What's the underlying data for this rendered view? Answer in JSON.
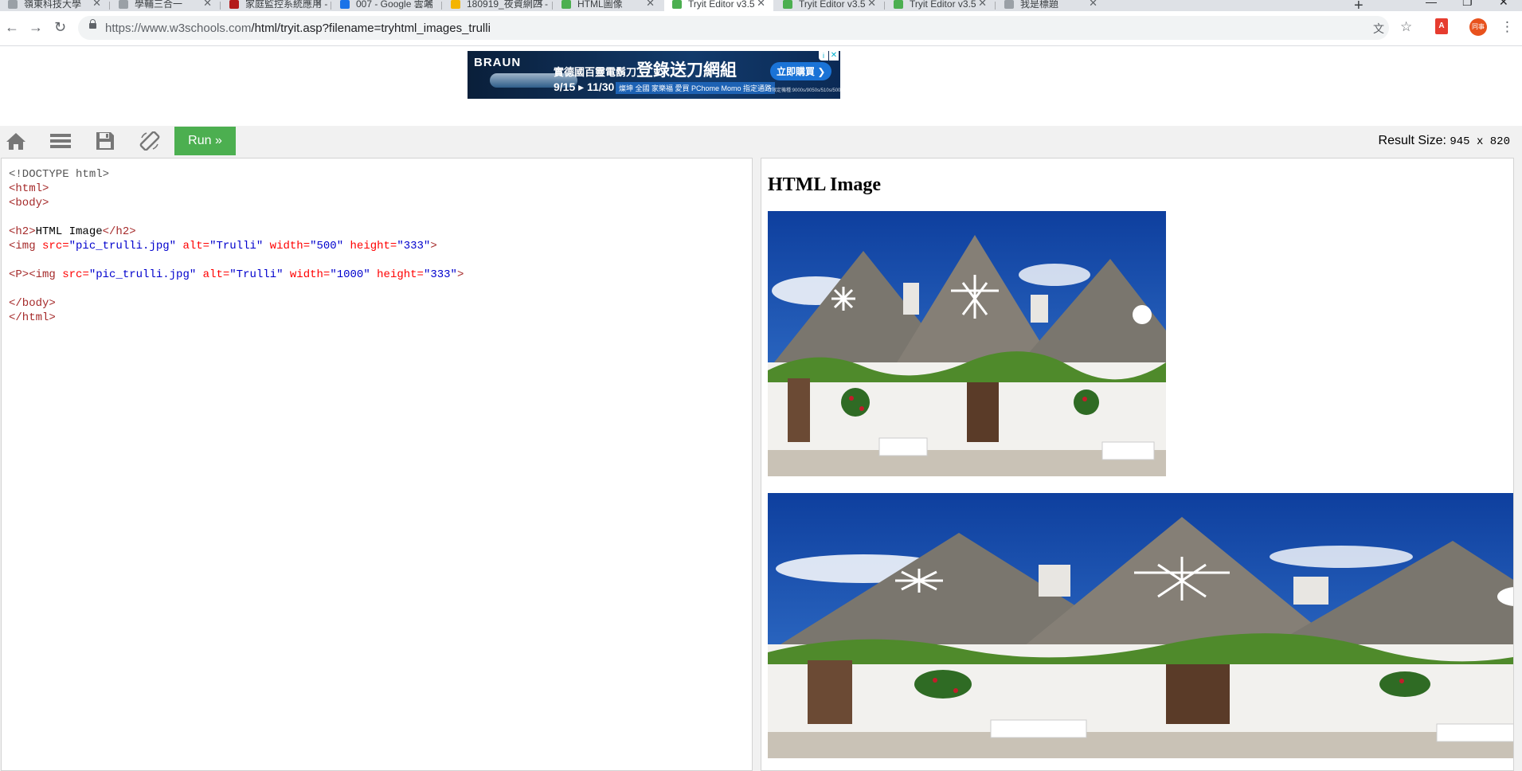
{
  "browser": {
    "tabs": [
      {
        "title": "嶺東科技大學",
        "favicon_color": "#9aa0a6"
      },
      {
        "title": "學輔三合一",
        "favicon_color": "#9aa0a6"
      },
      {
        "title": "家庭監控系統應用 -",
        "favicon_color": "#b31b1b"
      },
      {
        "title": "007 - Google 雲端",
        "favicon_color": "#1a73e8"
      },
      {
        "title": "180919_夜資網四 -",
        "favicon_color": "#f4b400"
      },
      {
        "title": "HTML圖像",
        "favicon_color": "#4caf50"
      },
      {
        "title": "Tryit Editor v3.5",
        "favicon_color": "#4caf50",
        "active": true
      },
      {
        "title": "Tryit Editor v3.5",
        "favicon_color": "#4caf50"
      },
      {
        "title": "Tryit Editor v3.5",
        "favicon_color": "#4caf50"
      },
      {
        "title": "我是標題",
        "favicon_color": "#9aa0a6"
      }
    ],
    "new_tab_label": "+",
    "url_host": "https://www.w3schools.com",
    "url_path": "/html/tryit.asp?filename=tryhtml_images_trulli",
    "profile_label": "同事"
  },
  "ad": {
    "brand": "BRAUN",
    "headline_small": "實德國百靈電鬍刀",
    "headline_big": "登錄送刀網組",
    "date_range": "9/15 ▸ 11/30",
    "sub": "燦坤 全國 家樂福 愛買 PChome Momo 指定通路",
    "cta": "立即購買 ❯",
    "fine_print": "限定機種:9000s/9050s/510s/500s"
  },
  "editor": {
    "run_label": "Run »",
    "result_size_label": "Result Size:",
    "result_size_value": "945 x 820"
  },
  "code_lines": [
    [
      {
        "t": "<!DOCTYPE html>",
        "c": "c-doc"
      }
    ],
    [
      {
        "t": "<html>",
        "c": "c-tag"
      }
    ],
    [
      {
        "t": "<body>",
        "c": "c-tag"
      }
    ],
    [],
    [
      {
        "t": "<h2>",
        "c": "c-tag"
      },
      {
        "t": "HTML Image",
        "c": "c-txt"
      },
      {
        "t": "</h2>",
        "c": "c-tag"
      }
    ],
    [
      {
        "t": "<img ",
        "c": "c-tag"
      },
      {
        "t": "src=",
        "c": "c-attr"
      },
      {
        "t": "\"pic_trulli.jpg\"",
        "c": "c-val"
      },
      {
        "t": " alt=",
        "c": "c-attr"
      },
      {
        "t": "\"Trulli\"",
        "c": "c-val"
      },
      {
        "t": " width=",
        "c": "c-attr"
      },
      {
        "t": "\"500\"",
        "c": "c-val"
      },
      {
        "t": " height=",
        "c": "c-attr"
      },
      {
        "t": "\"333\"",
        "c": "c-val"
      },
      {
        "t": ">",
        "c": "c-tag"
      }
    ],
    [],
    [
      {
        "t": "<P>",
        "c": "c-tag"
      },
      {
        "t": "<img ",
        "c": "c-tag"
      },
      {
        "t": "src=",
        "c": "c-attr"
      },
      {
        "t": "\"pic_trulli.jpg\"",
        "c": "c-val"
      },
      {
        "t": " alt=",
        "c": "c-attr"
      },
      {
        "t": "\"Trulli\"",
        "c": "c-val"
      },
      {
        "t": " width=",
        "c": "c-attr"
      },
      {
        "t": "\"1000\"",
        "c": "c-val"
      },
      {
        "t": " height=",
        "c": "c-attr"
      },
      {
        "t": "\"333\"",
        "c": "c-val"
      },
      {
        "t": ">",
        "c": "c-tag"
      }
    ],
    [],
    [
      {
        "t": "</body>",
        "c": "c-tag"
      }
    ],
    [
      {
        "t": "</html>",
        "c": "c-tag"
      }
    ]
  ],
  "result": {
    "heading": "HTML Image"
  },
  "colors": {
    "run_button": "#4caf50",
    "code_tag": "#a52a2a",
    "code_attr": "#ff0000",
    "code_value": "#0000cd"
  },
  "icons": [
    "home-icon",
    "menu-icon",
    "save-icon",
    "rotate-icon",
    "back-icon",
    "forward-icon",
    "reload-icon",
    "lock-icon",
    "translate-icon",
    "star-icon",
    "pdf-icon",
    "more-icon"
  ]
}
